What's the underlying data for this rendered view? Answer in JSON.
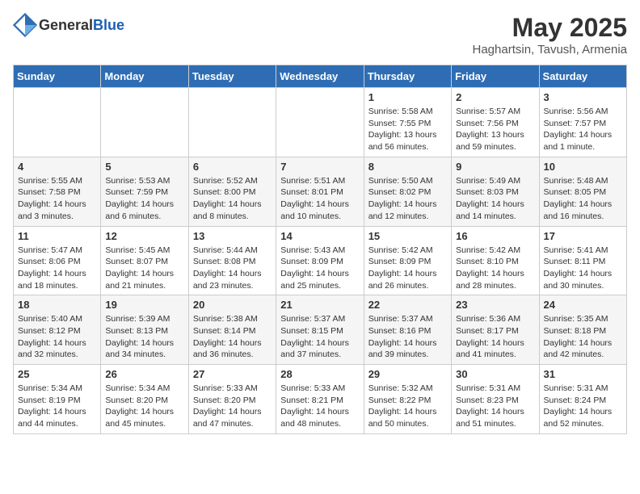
{
  "header": {
    "logo_general": "General",
    "logo_blue": "Blue",
    "month_year": "May 2025",
    "location": "Haghartsin, Tavush, Armenia"
  },
  "weekdays": [
    "Sunday",
    "Monday",
    "Tuesday",
    "Wednesday",
    "Thursday",
    "Friday",
    "Saturday"
  ],
  "weeks": [
    [
      {
        "num": "",
        "info": ""
      },
      {
        "num": "",
        "info": ""
      },
      {
        "num": "",
        "info": ""
      },
      {
        "num": "",
        "info": ""
      },
      {
        "num": "1",
        "info": "Sunrise: 5:58 AM\nSunset: 7:55 PM\nDaylight: 13 hours\nand 56 minutes."
      },
      {
        "num": "2",
        "info": "Sunrise: 5:57 AM\nSunset: 7:56 PM\nDaylight: 13 hours\nand 59 minutes."
      },
      {
        "num": "3",
        "info": "Sunrise: 5:56 AM\nSunset: 7:57 PM\nDaylight: 14 hours\nand 1 minute."
      }
    ],
    [
      {
        "num": "4",
        "info": "Sunrise: 5:55 AM\nSunset: 7:58 PM\nDaylight: 14 hours\nand 3 minutes."
      },
      {
        "num": "5",
        "info": "Sunrise: 5:53 AM\nSunset: 7:59 PM\nDaylight: 14 hours\nand 6 minutes."
      },
      {
        "num": "6",
        "info": "Sunrise: 5:52 AM\nSunset: 8:00 PM\nDaylight: 14 hours\nand 8 minutes."
      },
      {
        "num": "7",
        "info": "Sunrise: 5:51 AM\nSunset: 8:01 PM\nDaylight: 14 hours\nand 10 minutes."
      },
      {
        "num": "8",
        "info": "Sunrise: 5:50 AM\nSunset: 8:02 PM\nDaylight: 14 hours\nand 12 minutes."
      },
      {
        "num": "9",
        "info": "Sunrise: 5:49 AM\nSunset: 8:03 PM\nDaylight: 14 hours\nand 14 minutes."
      },
      {
        "num": "10",
        "info": "Sunrise: 5:48 AM\nSunset: 8:05 PM\nDaylight: 14 hours\nand 16 minutes."
      }
    ],
    [
      {
        "num": "11",
        "info": "Sunrise: 5:47 AM\nSunset: 8:06 PM\nDaylight: 14 hours\nand 18 minutes."
      },
      {
        "num": "12",
        "info": "Sunrise: 5:45 AM\nSunset: 8:07 PM\nDaylight: 14 hours\nand 21 minutes."
      },
      {
        "num": "13",
        "info": "Sunrise: 5:44 AM\nSunset: 8:08 PM\nDaylight: 14 hours\nand 23 minutes."
      },
      {
        "num": "14",
        "info": "Sunrise: 5:43 AM\nSunset: 8:09 PM\nDaylight: 14 hours\nand 25 minutes."
      },
      {
        "num": "15",
        "info": "Sunrise: 5:42 AM\nSunset: 8:09 PM\nDaylight: 14 hours\nand 26 minutes."
      },
      {
        "num": "16",
        "info": "Sunrise: 5:42 AM\nSunset: 8:10 PM\nDaylight: 14 hours\nand 28 minutes."
      },
      {
        "num": "17",
        "info": "Sunrise: 5:41 AM\nSunset: 8:11 PM\nDaylight: 14 hours\nand 30 minutes."
      }
    ],
    [
      {
        "num": "18",
        "info": "Sunrise: 5:40 AM\nSunset: 8:12 PM\nDaylight: 14 hours\nand 32 minutes."
      },
      {
        "num": "19",
        "info": "Sunrise: 5:39 AM\nSunset: 8:13 PM\nDaylight: 14 hours\nand 34 minutes."
      },
      {
        "num": "20",
        "info": "Sunrise: 5:38 AM\nSunset: 8:14 PM\nDaylight: 14 hours\nand 36 minutes."
      },
      {
        "num": "21",
        "info": "Sunrise: 5:37 AM\nSunset: 8:15 PM\nDaylight: 14 hours\nand 37 minutes."
      },
      {
        "num": "22",
        "info": "Sunrise: 5:37 AM\nSunset: 8:16 PM\nDaylight: 14 hours\nand 39 minutes."
      },
      {
        "num": "23",
        "info": "Sunrise: 5:36 AM\nSunset: 8:17 PM\nDaylight: 14 hours\nand 41 minutes."
      },
      {
        "num": "24",
        "info": "Sunrise: 5:35 AM\nSunset: 8:18 PM\nDaylight: 14 hours\nand 42 minutes."
      }
    ],
    [
      {
        "num": "25",
        "info": "Sunrise: 5:34 AM\nSunset: 8:19 PM\nDaylight: 14 hours\nand 44 minutes."
      },
      {
        "num": "26",
        "info": "Sunrise: 5:34 AM\nSunset: 8:20 PM\nDaylight: 14 hours\nand 45 minutes."
      },
      {
        "num": "27",
        "info": "Sunrise: 5:33 AM\nSunset: 8:20 PM\nDaylight: 14 hours\nand 47 minutes."
      },
      {
        "num": "28",
        "info": "Sunrise: 5:33 AM\nSunset: 8:21 PM\nDaylight: 14 hours\nand 48 minutes."
      },
      {
        "num": "29",
        "info": "Sunrise: 5:32 AM\nSunset: 8:22 PM\nDaylight: 14 hours\nand 50 minutes."
      },
      {
        "num": "30",
        "info": "Sunrise: 5:31 AM\nSunset: 8:23 PM\nDaylight: 14 hours\nand 51 minutes."
      },
      {
        "num": "31",
        "info": "Sunrise: 5:31 AM\nSunset: 8:24 PM\nDaylight: 14 hours\nand 52 minutes."
      }
    ]
  ]
}
